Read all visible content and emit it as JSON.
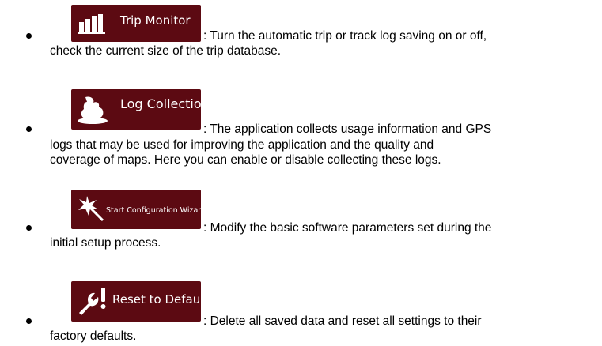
{
  "items": [
    {
      "button_label": "Trip Monitor",
      "icon": "bar-chart-icon",
      "line1": ": Turn the automatic trip or track log saving on or off,",
      "line2": "check the current size of the trip database."
    },
    {
      "button_label": "Log Collection",
      "icon": "log-bag-icon",
      "line1": ": The application collects usage information and GPS",
      "line2": "logs that may be used for improving the application and the quality and",
      "line3": "coverage of maps. Here you can enable or disable collecting these logs."
    },
    {
      "button_label": "Start Configuration Wizard",
      "icon": "magic-wand-icon",
      "line1": ": Modify the basic software parameters set during the",
      "line2": "initial setup process."
    },
    {
      "button_label": "Reset to Defaults",
      "icon": "wrench-reset-icon",
      "line1": ": Delete all saved data and reset all settings to their",
      "line2": "factory defaults."
    }
  ],
  "colors": {
    "button_bg": "#5c0a12",
    "button_text": "#ffffff"
  }
}
